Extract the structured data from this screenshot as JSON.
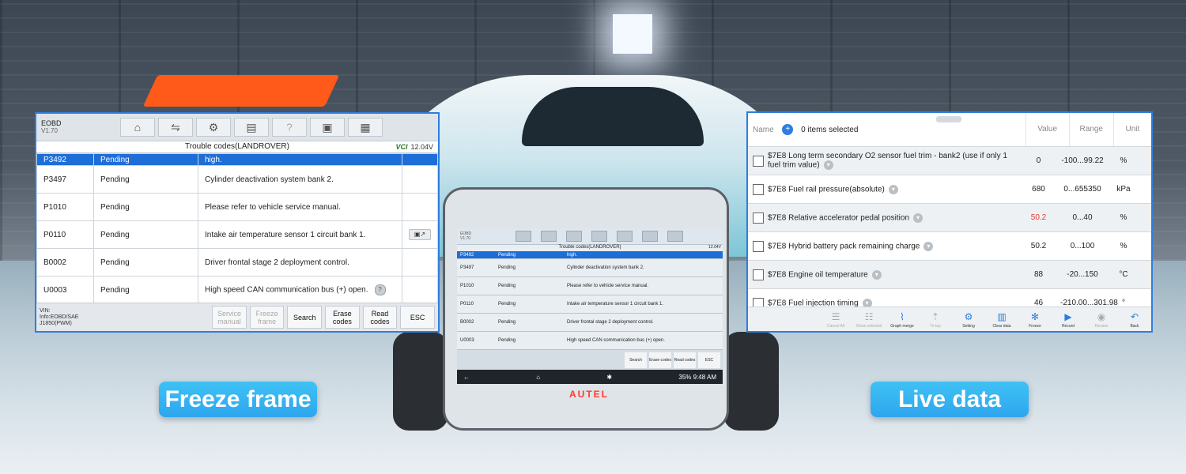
{
  "captions": {
    "left": "Freeze frame",
    "right": "Live data"
  },
  "freeze_panel": {
    "app": "EOBD",
    "version": "V1.70",
    "toolbar_icons": [
      "home-icon",
      "car-lift-icon",
      "gear-icon",
      "printer-icon",
      "help-icon",
      "save-icon",
      "message-icon"
    ],
    "title": "Trouble codes(LANDROVER)",
    "vci": "VCI",
    "voltage": "12.04V",
    "partial_row": {
      "code": "P3492",
      "status": "Pending",
      "desc": "high."
    },
    "rows": [
      {
        "code": "P3497",
        "status": "Pending",
        "desc": "Cylinder deactivation system bank 2."
      },
      {
        "code": "P1010",
        "status": "Pending",
        "desc": "Please refer to vehicle service manual."
      },
      {
        "code": "P0110",
        "status": "Pending",
        "desc": "Intake air temperature sensor 1 circuit bank 1."
      },
      {
        "code": "B0002",
        "status": "Pending",
        "desc": "Driver frontal stage 2 deployment control."
      },
      {
        "code": "U0003",
        "status": "Pending",
        "desc": "High speed CAN communication bus (+) open."
      }
    ],
    "vin": {
      "l1": "VIN:",
      "l2": "Info:EOBD/SAE",
      "l3": "J1850(PWM)"
    },
    "buttons": {
      "service_manual": "Service manual",
      "freeze_frame": "Freeze frame",
      "search": "Search",
      "erase_codes": "Erase codes",
      "read_codes": "Read codes",
      "esc": "ESC"
    }
  },
  "live_panel": {
    "name_label": "Name",
    "selected": "0 items selected",
    "col_value": "Value",
    "col_range": "Range",
    "col_unit": "Unit",
    "rows": [
      {
        "name": "$7E8 Long term secondary O2 sensor fuel trim - bank2 (use if only 1 fuel trim value)",
        "value": "0",
        "range": "-100...99.22",
        "unit": "%"
      },
      {
        "name": "$7E8 Fuel rail pressure(absolute)",
        "value": "680",
        "range": "0...655350",
        "unit": "kPa"
      },
      {
        "name": "$7E8 Relative accelerator pedal position",
        "value": "50.2",
        "range": "0...40",
        "unit": "%"
      },
      {
        "name": "$7E8 Hybrid battery pack remaining charge",
        "value": "50.2",
        "range": "0...100",
        "unit": "%"
      },
      {
        "name": "$7E8 Engine oil temperature",
        "value": "88",
        "range": "-20...150",
        "unit": "°C"
      },
      {
        "name": "$7E8 Fuel injection timing",
        "value": "46",
        "range": "-210.00...301.98",
        "unit": "°"
      }
    ],
    "tools": [
      "Cancel All",
      "Show selected",
      "Graph merge",
      "To top",
      "Setting",
      "Clear data",
      "Freeze",
      "Record",
      "Review",
      "Back"
    ]
  },
  "tablet": {
    "brand": "AUTEL",
    "status": "35% 9:48 AM"
  }
}
